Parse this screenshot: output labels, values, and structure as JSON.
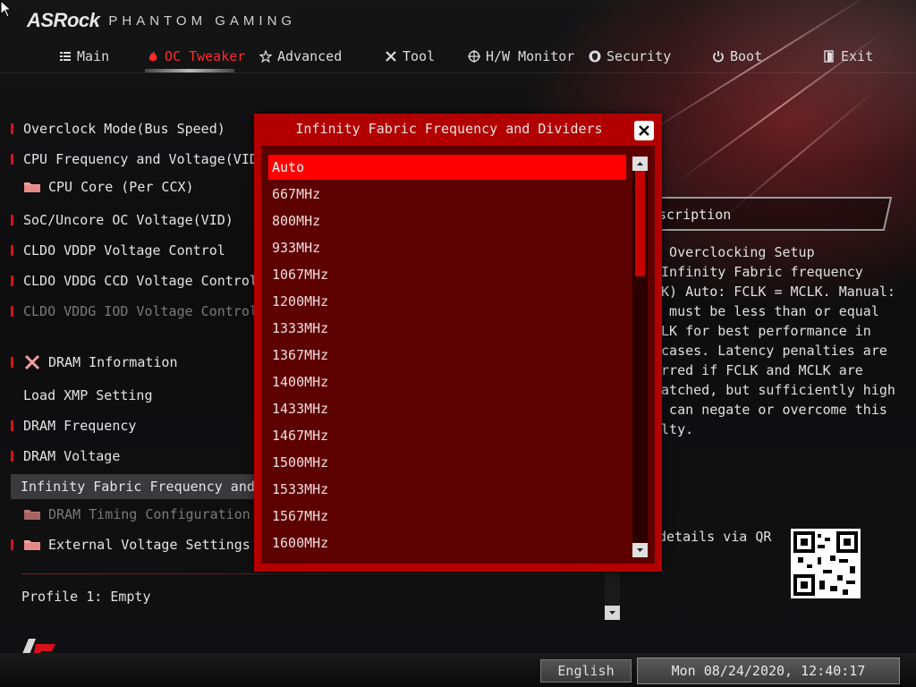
{
  "header": {
    "brand": "ASRock",
    "product": "PHANTOM GAMING"
  },
  "nav": [
    {
      "label": "Main",
      "icon": "list-icon"
    },
    {
      "label": "OC Tweaker",
      "icon": "flame-icon",
      "active": true
    },
    {
      "label": "Advanced",
      "icon": "star-icon"
    },
    {
      "label": "Tool",
      "icon": "tools-icon"
    },
    {
      "label": "H/W Monitor",
      "icon": "crosshair-icon"
    },
    {
      "label": "Security",
      "icon": "shield-icon"
    },
    {
      "label": "Boot",
      "icon": "power-icon"
    },
    {
      "label": "Exit",
      "icon": "exit-door-icon"
    }
  ],
  "menu": [
    {
      "label": "Overclock Mode(Bus Speed)"
    },
    {
      "label": "CPU Frequency and Voltage(VID) Ch"
    },
    {
      "label": "CPU Core (Per CCX)",
      "folder": true
    },
    {
      "label": "SoC/Uncore OC Voltage(VID)"
    },
    {
      "label": "CLDO VDDP Voltage Control"
    },
    {
      "label": "CLDO VDDG CCD Voltage Control"
    },
    {
      "label": "CLDO VDDG IOD Voltage Control",
      "disabled": true
    },
    {
      "label": "DRAM Information",
      "tool": true
    },
    {
      "label": "Load XMP Setting"
    },
    {
      "label": "DRAM Frequency"
    },
    {
      "label": "DRAM Voltage"
    },
    {
      "label": "Infinity Fabric Frequency and Di",
      "selected": true
    },
    {
      "label": "DRAM Timing Configuration",
      "folder": true,
      "disabled": true
    },
    {
      "label": "External Voltage Settings a",
      "folder": true
    }
  ],
  "profile": "Profile 1: Empty",
  "description": {
    "title": "scription",
    "text": ") Overclocking Setup\n Infinity Fabric frequency\nLK) Auto: FCLK = MCLK. Manual:\nK must be less than or equal\nCLK for best performance in\n cases. Latency penalties are\nurred if FCLK and MCLK are\nmatched, but sufficiently high\nK can negate or overcome this\nalty."
  },
  "qr_label": "details via QR",
  "language": "English",
  "datetime": "Mon 08/24/2020, 12:40:17",
  "modal": {
    "title": "Infinity Fabric Frequency and Dividers",
    "options": [
      "Auto",
      "667MHz",
      "800MHz",
      "933MHz",
      "1067MHz",
      "1200MHz",
      "1333MHz",
      "1367MHz",
      "1400MHz",
      "1433MHz",
      "1467MHz",
      "1500MHz",
      "1533MHz",
      "1567MHz",
      "1600MHz"
    ],
    "selected_index": 0
  },
  "colors": {
    "accent": "#ff0000",
    "modal_frame": "#b20000",
    "modal_body": "#5d0000",
    "menu_bar": "#d8101c"
  }
}
